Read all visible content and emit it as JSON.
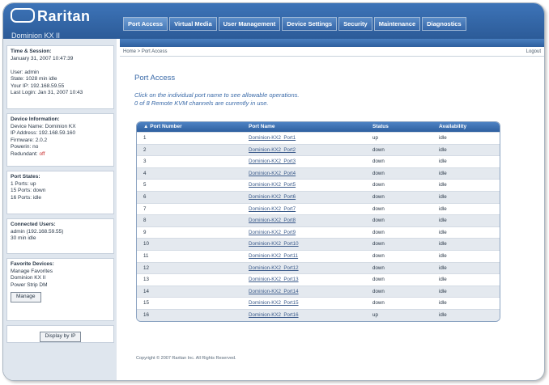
{
  "app": {
    "logo": "Raritan",
    "device_title": "Dominion KX II"
  },
  "tabs": [
    {
      "label": "Port Access",
      "active": true
    },
    {
      "label": "Virtual Media",
      "active": false
    },
    {
      "label": "User Management",
      "active": false
    },
    {
      "label": "Device Settings",
      "active": false
    },
    {
      "label": "Security",
      "active": false
    },
    {
      "label": "Maintenance",
      "active": false
    },
    {
      "label": "Diagnostics",
      "active": false
    }
  ],
  "breadcrumb": "Home > Port Access",
  "logout_label": "Logout",
  "sidebar": {
    "session": [
      "Time & Session:",
      "January 31, 2007 10:47:39",
      "",
      "User: admin",
      "State: 1028 min idle",
      "Your IP: 192.168.59.55",
      "Last Login: Jan 31, 2007 10:43"
    ],
    "device": [
      "Device Information:",
      "Device Name: Dominion KX",
      "IP Address: 192.168.59.160",
      "Firmware: 2.0.2",
      "Powerin: no"
    ],
    "device_warning_label": "Redundant:",
    "device_warning_value": "off",
    "port_states": [
      "Port States:",
      "1 Ports: up",
      "15 Ports: down",
      "16 Ports: idle"
    ],
    "connected": [
      "Connected Users:",
      "admin (192.168.59.55)",
      "  30 min idle"
    ],
    "favorites": [
      "Favorite Devices:",
      "Manage Favorites",
      "Dominion KX II",
      "Power Strip DM"
    ],
    "manage_label": "Manage",
    "bottom_button": "Display by IP"
  },
  "main": {
    "title": "Port Access",
    "instructions": [
      "Click on the individual port name to see allowable operations.",
      "0 of 8 Remote KVM channels are currently in use."
    ],
    "columns": [
      "▲ Port Number",
      "Port Name",
      "Status",
      "Availability"
    ],
    "rows": [
      {
        "num": "1",
        "name": "Dominion-KX2_Port1",
        "status": "up",
        "avail": "idle"
      },
      {
        "num": "2",
        "name": "Dominion-KX2_Port2",
        "status": "down",
        "avail": "idle"
      },
      {
        "num": "3",
        "name": "Dominion-KX2_Port3",
        "status": "down",
        "avail": "idle"
      },
      {
        "num": "4",
        "name": "Dominion-KX2_Port4",
        "status": "down",
        "avail": "idle"
      },
      {
        "num": "5",
        "name": "Dominion-KX2_Port5",
        "status": "down",
        "avail": "idle"
      },
      {
        "num": "6",
        "name": "Dominion-KX2_Port6",
        "status": "down",
        "avail": "idle"
      },
      {
        "num": "7",
        "name": "Dominion-KX2_Port7",
        "status": "down",
        "avail": "idle"
      },
      {
        "num": "8",
        "name": "Dominion-KX2_Port8",
        "status": "down",
        "avail": "idle"
      },
      {
        "num": "9",
        "name": "Dominion-KX2_Port9",
        "status": "down",
        "avail": "idle"
      },
      {
        "num": "10",
        "name": "Dominion-KX2_Port10",
        "status": "down",
        "avail": "idle"
      },
      {
        "num": "11",
        "name": "Dominion-KX2_Port11",
        "status": "down",
        "avail": "idle"
      },
      {
        "num": "12",
        "name": "Dominion-KX2_Port12",
        "status": "down",
        "avail": "idle"
      },
      {
        "num": "13",
        "name": "Dominion-KX2_Port13",
        "status": "down",
        "avail": "idle"
      },
      {
        "num": "14",
        "name": "Dominion-KX2_Port14",
        "status": "down",
        "avail": "idle"
      },
      {
        "num": "15",
        "name": "Dominion-KX2_Port15",
        "status": "down",
        "avail": "idle"
      },
      {
        "num": "16",
        "name": "Dominion-KX2_Port16",
        "status": "up",
        "avail": "idle"
      }
    ]
  },
  "footer": "Copyright © 2007 Raritan Inc. All Rights Reserved.",
  "colors": {
    "header_blue": "#2c5b98",
    "title_blue": "#3a6aa8",
    "warning_red": "#c83030"
  }
}
